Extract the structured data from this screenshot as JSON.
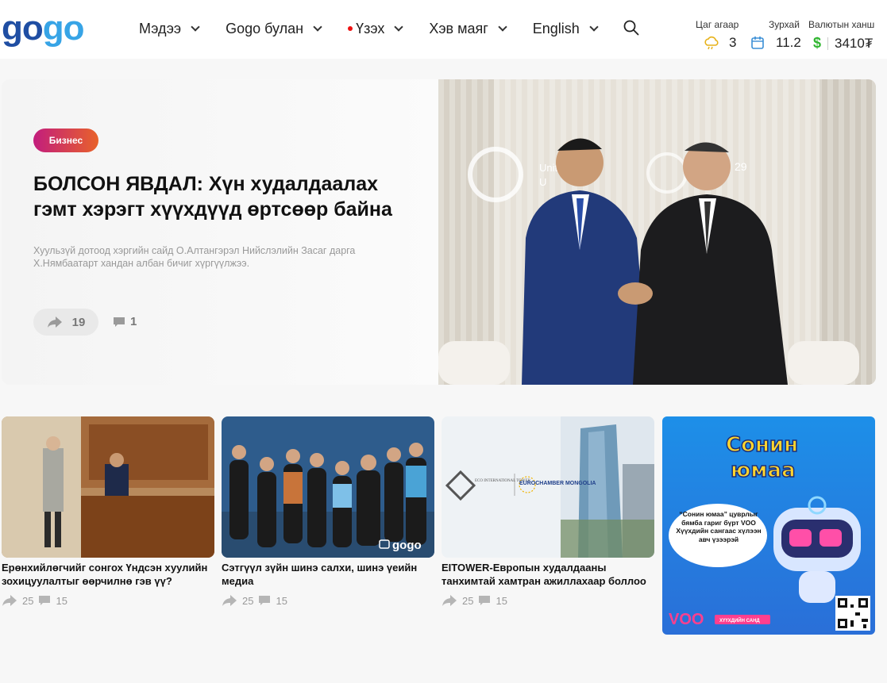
{
  "logo": {
    "part1": "go",
    "part2": "go"
  },
  "nav": [
    {
      "label": "Мэдээ"
    },
    {
      "label": "Gogo булан"
    },
    {
      "label": "Үзэх",
      "live": true
    },
    {
      "label": "Хэв маяг"
    },
    {
      "label": "English"
    }
  ],
  "widgets": {
    "weather_label": "Цаг агаар",
    "weather_value": "3",
    "calendar_label": "Зурхай",
    "calendar_value": "11.2",
    "currency_label": "Валютын ханш",
    "currency_value": "3410₮"
  },
  "hero": {
    "category": "Бизнес",
    "title": "БОЛСОН ЯВДАЛ: Хүн худалдаалах гэмт хэрэгт хүүхдүүд өртсөөр байна",
    "description": "Хуульзүй дотоод хэргийн сайд О.Алтангэрэл Нийслэлийн Засаг дарга Х.Нямбаатарт хандан албан бичиг хүргүүлжээ.",
    "shares": "19",
    "comments": "1"
  },
  "hero_image": {
    "sign_left": "Unit",
    "sign_left2": "U",
    "sign_right": "29"
  },
  "cards": [
    {
      "title": "Ерөнхийлөгчийг сонгох Үндсэн хуулийн зохицуулалтыг өөрчилнө гэв үү?",
      "shares": "25",
      "comments": "15"
    },
    {
      "title": "Сэтгүүл зүйн шинэ салхи, шинэ үеийн медиа",
      "shares": "25",
      "comments": "15",
      "watermark": "gogo"
    },
    {
      "title": "EITOWER-Европын худалдааны танхимтай хамтран ажиллахаар боллоо",
      "shares": "25",
      "comments": "15",
      "brand1": "ECO INTERNATIONAL TOWER",
      "brand2": "EUROCHAMBER MONGOLIA"
    }
  ],
  "ad": {
    "title_line1": "Сонин",
    "title_line2": "юмаа",
    "bubble": "“Сонин юмаа” цуврлыг бямба гариг бүрт VOO Хүүхдийн сангаас хүлээн авч үзээрэй",
    "brand": "VOO",
    "footer": "ХҮҮХДИЙН САНД"
  }
}
